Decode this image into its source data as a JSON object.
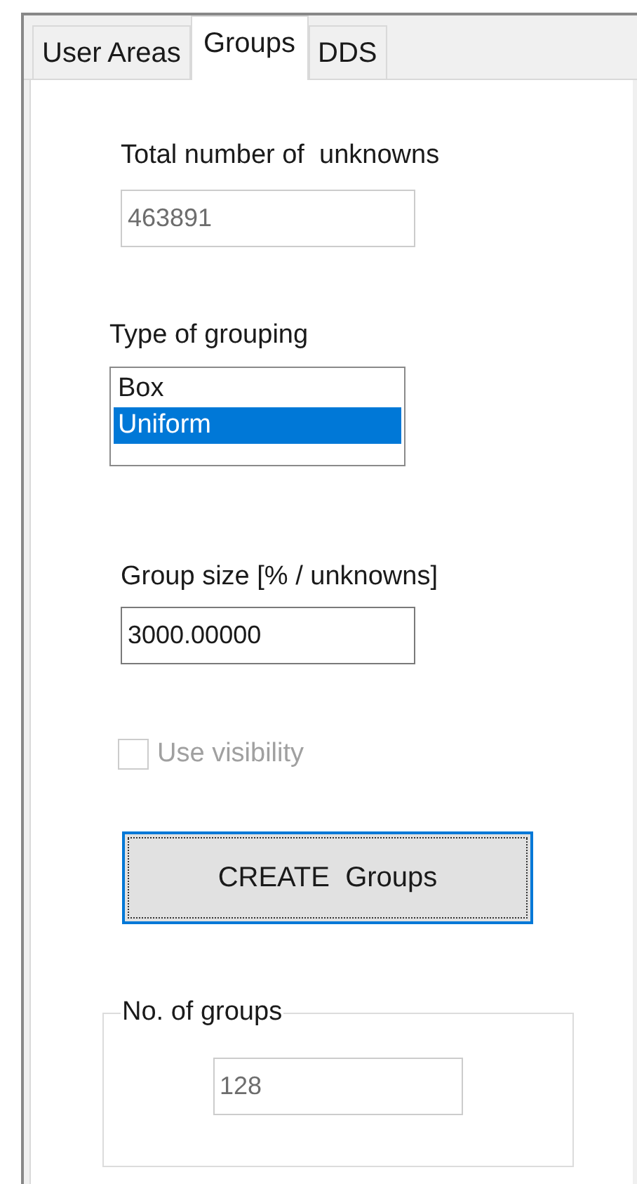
{
  "tabs": [
    {
      "label": "User Areas",
      "selected": false
    },
    {
      "label": "Groups",
      "selected": true
    },
    {
      "label": "DDS",
      "selected": false
    }
  ],
  "total_unknowns": {
    "label": "Total number of  unknowns",
    "value": "463891",
    "disabled": true
  },
  "grouping": {
    "label": "Type of grouping",
    "items": [
      {
        "label": "Box",
        "selected": false
      },
      {
        "label": "Uniform",
        "selected": true
      }
    ]
  },
  "group_size": {
    "label": "Group size [% / unknowns]",
    "value": "3000.00000",
    "disabled": false
  },
  "use_visibility": {
    "label": "Use visibility",
    "checked": false,
    "disabled": true
  },
  "create_button": {
    "label": "CREATE  Groups",
    "focused": true
  },
  "groups_box": {
    "legend": "No. of groups",
    "value": "128",
    "disabled": true
  }
}
